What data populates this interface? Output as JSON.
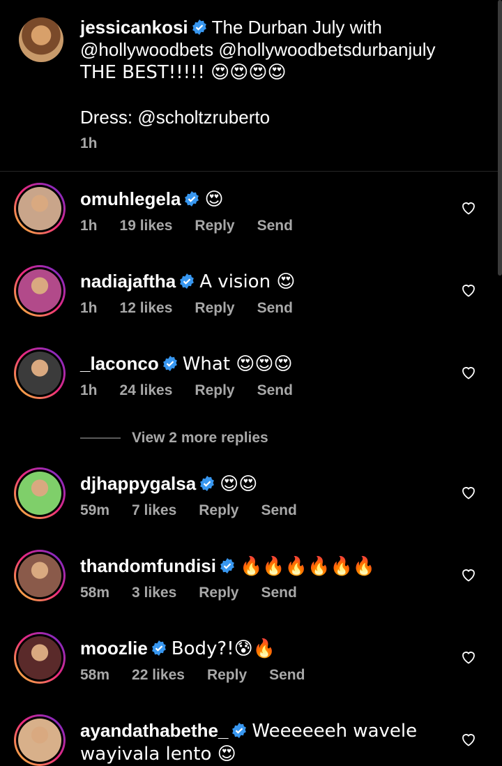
{
  "caption": {
    "username": "jessicankosi",
    "text_line1": "The Durban July with",
    "text_line2": "@hollywoodbets @hollywoodbetsdurbanjuly",
    "text_line3": "THE BEST!!!!! 😍😍😍😍",
    "text_line4": "Dress: @scholtzruberto",
    "time": "1h"
  },
  "comments": [
    {
      "username": "omuhlegela",
      "text": "😍",
      "time": "1h",
      "likes": "19 likes",
      "reply": "Reply",
      "send": "Send"
    },
    {
      "username": "nadiajaftha",
      "text": "A vision 😍",
      "time": "1h",
      "likes": "12 likes",
      "reply": "Reply",
      "send": "Send"
    },
    {
      "username": "_laconco",
      "text": "What 😍😍😍",
      "time": "1h",
      "likes": "24 likes",
      "reply": "Reply",
      "send": "Send"
    },
    {
      "username": "djhappygalsa",
      "text": "😍😍",
      "time": "59m",
      "likes": "7 likes",
      "reply": "Reply",
      "send": "Send"
    },
    {
      "username": "thandomfundisi",
      "text": "🔥🔥🔥🔥🔥🔥",
      "time": "58m",
      "likes": "3 likes",
      "reply": "Reply",
      "send": "Send"
    },
    {
      "username": "moozlie",
      "text": "Body?!😰🔥",
      "time": "58m",
      "likes": "22 likes",
      "reply": "Reply",
      "send": "Send"
    },
    {
      "username": "ayandathabethe_",
      "text": "Weeeeeeh wavele",
      "text2": "wayivala lento 😍"
    }
  ],
  "view_more": "View 2 more replies",
  "colors": {
    "verified": "#3897f0",
    "muted": "#a8a8a8"
  }
}
